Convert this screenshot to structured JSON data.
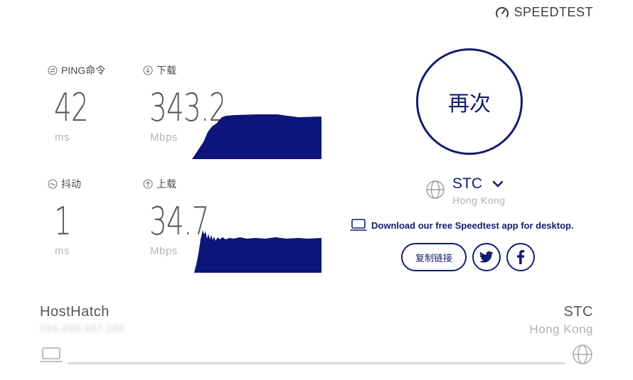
{
  "brand": {
    "name": "SPEEDTEST",
    "icon": "speedometer-icon"
  },
  "metrics": {
    "ping": {
      "label": "PING命令",
      "value": "42",
      "unit": "ms",
      "icon": "ping-icon"
    },
    "download": {
      "label": "下载",
      "value": "343.2",
      "unit": "Mbps",
      "icon": "download-arrow-icon",
      "color": "#0d157a"
    },
    "jitter": {
      "label": "抖动",
      "value": "1",
      "unit": "ms",
      "icon": "jitter-icon"
    },
    "upload": {
      "label": "上载",
      "value": "34.7",
      "unit": "Mbps",
      "icon": "upload-arrow-icon",
      "color": "#0d157a"
    }
  },
  "again_button": {
    "label": "再次"
  },
  "server": {
    "name": "STC",
    "location": "Hong Kong",
    "icon": "globe-icon"
  },
  "download_app": {
    "text": "Download our free Speedtest app for desktop.",
    "icon": "laptop-icon"
  },
  "share": {
    "copy_link_label": "复制链接",
    "twitter_icon": "twitter-icon",
    "facebook_icon": "facebook-icon"
  },
  "client": {
    "isp": "HostHatch",
    "ip": "104.250.167.150"
  },
  "destination": {
    "name": "STC",
    "location": "Hong Kong"
  },
  "colors": {
    "accent": "#141c6e",
    "graph_fill": "#0d157a"
  }
}
